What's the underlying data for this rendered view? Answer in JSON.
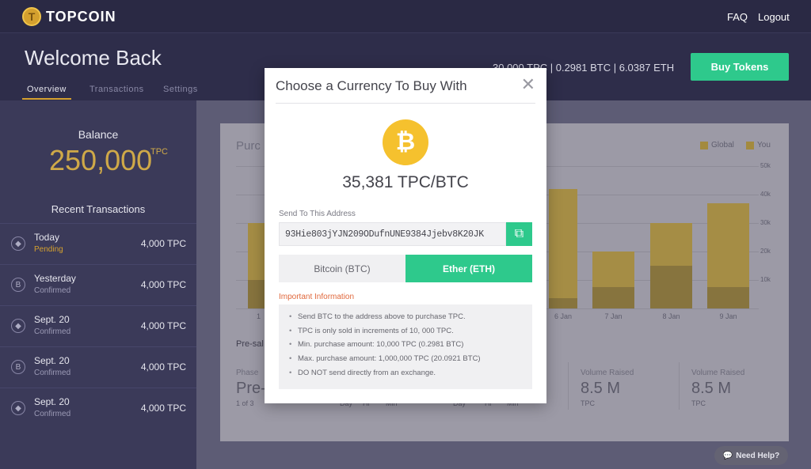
{
  "app": {
    "name": "TOPCOIN",
    "logo_glyph": "T"
  },
  "nav": {
    "faq": "FAQ",
    "logout": "Logout"
  },
  "header": {
    "welcome": "Welcome Back",
    "tabs": [
      "Overview",
      "Transactions",
      "Settings"
    ],
    "balance_summary": "30,000 TPC | 0.2981 BTC | 6.0387 ETH",
    "buy_tokens": "Buy Tokens"
  },
  "sidebar": {
    "balance_label": "Balance",
    "balance_value": "250,000",
    "balance_unit": "TPC",
    "recent_label": "Recent Transactions",
    "transactions": [
      {
        "icon": "ether-icon",
        "date": "Today",
        "status": "Pending",
        "amount": "4,000 TPC"
      },
      {
        "icon": "bitcoin-icon",
        "date": "Yesterday",
        "status": "Confirmed",
        "amount": "4,000 TPC"
      },
      {
        "icon": "ether-icon",
        "date": "Sept. 20",
        "status": "Confirmed",
        "amount": "4,000 TPC"
      },
      {
        "icon": "bitcoin-icon",
        "date": "Sept. 20",
        "status": "Confirmed",
        "amount": "4,000 TPC"
      },
      {
        "icon": "ether-icon",
        "date": "Sept. 20",
        "status": "Confirmed",
        "amount": "4,000 TPC"
      }
    ]
  },
  "chart": {
    "title": "Purc",
    "legend": [
      "Global",
      "You"
    ]
  },
  "chart_data": {
    "type": "bar",
    "categories": [
      "1",
      "6 Jan",
      "7 Jan",
      "8 Jan",
      "9 Jan"
    ],
    "series": [
      {
        "name": "Global",
        "values": [
          30000,
          42000,
          20000,
          30000,
          37000
        ]
      },
      {
        "name": "You",
        "values": [
          10000,
          3500,
          7500,
          15000,
          7500
        ]
      }
    ],
    "yticks": [
      "10k",
      "20k",
      "30k",
      "40k",
      "50k"
    ],
    "ylim": [
      0,
      50000
    ]
  },
  "stats": {
    "presale": "Pre-sal",
    "phase_label": "Phase",
    "phase_value": "Pre-",
    "phase_sub": "1 of 3",
    "time_units": [
      "Day",
      "Hr",
      "Min",
      "Day",
      "Hr",
      "Min"
    ],
    "volume_label": "Volume Raised",
    "volume_value": "8.5 M",
    "volume_unit": "TPC"
  },
  "help": {
    "label": "Need Help?"
  },
  "modal": {
    "title": "Choose a Currency To Buy With",
    "rate": "35,381 TPC/BTC",
    "address_label": "Send To This Address",
    "address": "93Hie803jYJN209ODufnUNE9384Jjebv8K20JK",
    "option_btc": "Bitcoin (BTC)",
    "option_eth": "Ether (ETH)",
    "important_label": "Important Information",
    "info": [
      "Send BTC to the address above to purchase TPC.",
      "TPC is only sold in increments of 10, 000 TPC.",
      "Min. purchase amount: 10,000 TPC (0.2981 BTC)",
      "Max. purchase amount: 1,000,000 TPC (20.0921 BTC)",
      "DO NOT send directly from an exchange."
    ]
  },
  "colors": {
    "accent_green": "#2ec98c",
    "gold": "#d4a02e",
    "bitcoin": "#f5c12e"
  }
}
